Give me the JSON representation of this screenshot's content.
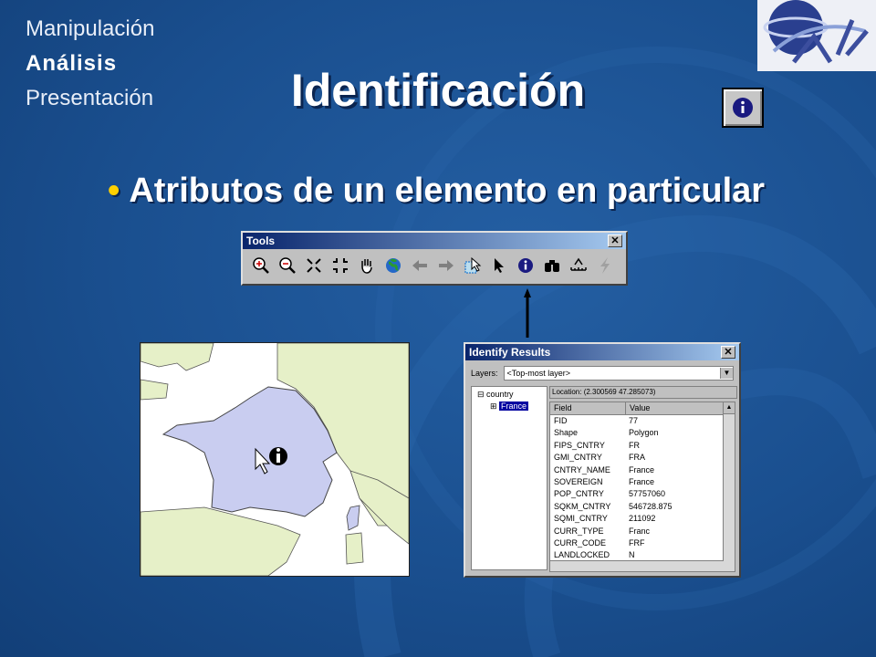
{
  "nav": {
    "items": [
      "Manipulación",
      "Análisis",
      "Presentación"
    ],
    "active": "Análisis"
  },
  "slide": {
    "title": "Identificación",
    "bullet": "Atributos de un elemento en particular"
  },
  "tools_window": {
    "title": "Tools",
    "icons": [
      "zoom-in-icon",
      "zoom-out-icon",
      "fixed-zoom-in-icon",
      "fixed-zoom-out-icon",
      "pan-hand-icon",
      "full-extent-globe-icon",
      "back-arrow-icon",
      "forward-arrow-icon",
      "select-features-icon",
      "select-elements-pointer-icon",
      "identify-icon",
      "find-binoculars-icon",
      "measure-icon",
      "hyperlink-lightning-icon"
    ]
  },
  "identify_window": {
    "title": "Identify Results",
    "layers_label": "Layers:",
    "layers_value": "<Top-most layer>",
    "tree_root": "country",
    "tree_child": "France",
    "location": "Location: (2.300569 47.285073)",
    "columns": [
      "Field",
      "Value"
    ],
    "rows": [
      [
        "FID",
        "77"
      ],
      [
        "Shape",
        "Polygon"
      ],
      [
        "FIPS_CNTRY",
        "FR"
      ],
      [
        "GMI_CNTRY",
        "FRA"
      ],
      [
        "CNTRY_NAME",
        "France"
      ],
      [
        "SOVEREIGN",
        "France"
      ],
      [
        "POP_CNTRY",
        "57757060"
      ],
      [
        "SQKM_CNTRY",
        "546728.875"
      ],
      [
        "SQMI_CNTRY",
        "211092"
      ],
      [
        "CURR_TYPE",
        "Franc"
      ],
      [
        "CURR_CODE",
        "FRF"
      ],
      [
        "LANDLOCKED",
        "N"
      ]
    ]
  },
  "colors": {
    "background": "#1a4f8f",
    "bullet": "#ffd000",
    "map_land": "#e6f0c8",
    "map_france": "#c9cdf0",
    "map_water": "#ffffff"
  }
}
